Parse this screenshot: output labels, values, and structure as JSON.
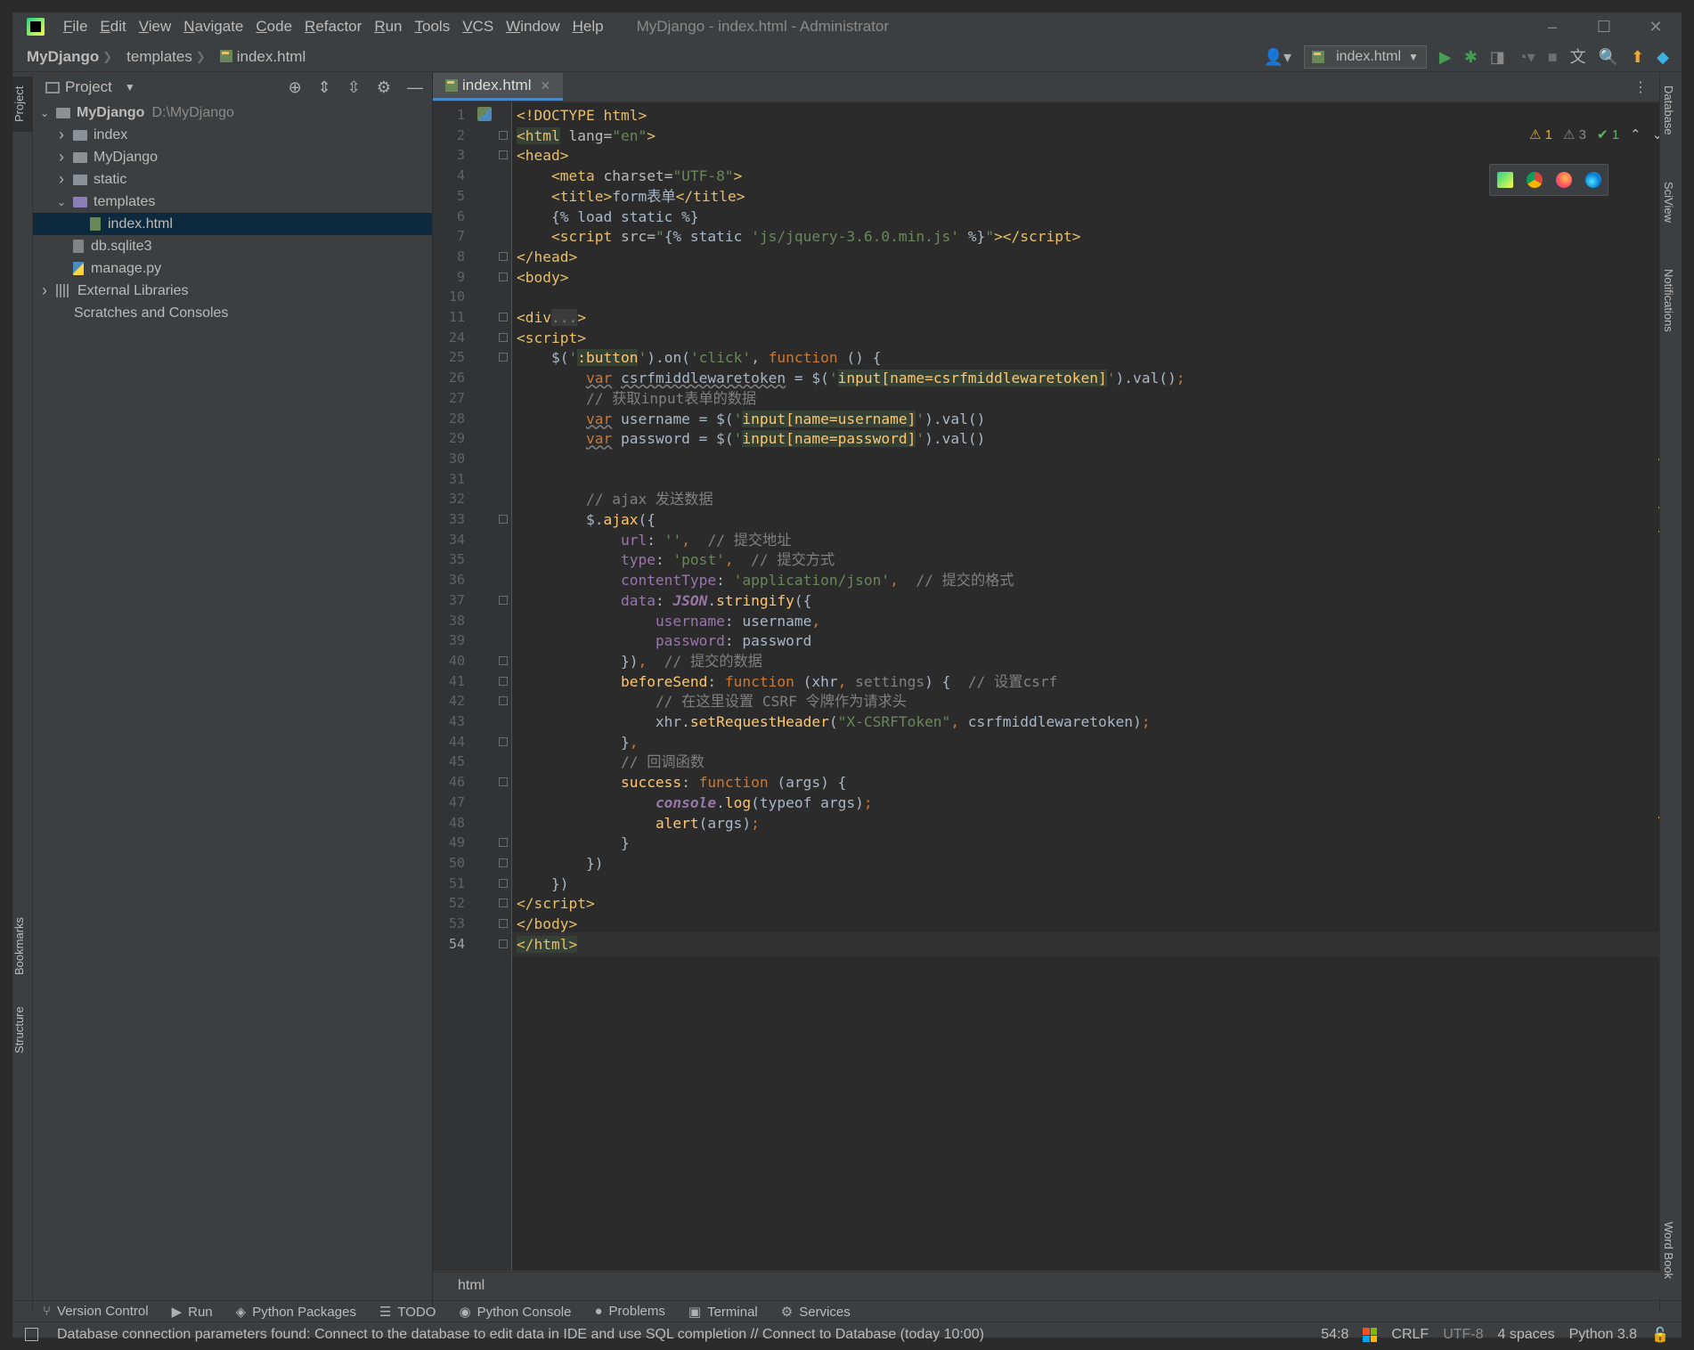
{
  "window": {
    "title": "MyDjango - index.html - Administrator",
    "menu": [
      "File",
      "Edit",
      "View",
      "Navigate",
      "Code",
      "Refactor",
      "Run",
      "Tools",
      "VCS",
      "Window",
      "Help"
    ],
    "controls": [
      "–",
      "☐",
      "✕"
    ]
  },
  "navbar": {
    "crumbs": [
      "MyDjango",
      "templates",
      "index.html"
    ],
    "run_config": "index.html"
  },
  "project_panel": {
    "title": "Project",
    "tree": [
      {
        "label": "MyDjango",
        "detail": "D:\\MyDjango",
        "level": 0,
        "expanded": true,
        "type": "project"
      },
      {
        "label": "index",
        "level": 1,
        "expanded": false,
        "type": "folder"
      },
      {
        "label": "MyDjango",
        "level": 1,
        "expanded": false,
        "type": "folder"
      },
      {
        "label": "static",
        "level": 1,
        "expanded": false,
        "type": "folder"
      },
      {
        "label": "templates",
        "level": 1,
        "expanded": true,
        "type": "template-folder"
      },
      {
        "label": "index.html",
        "level": 2,
        "type": "html",
        "selected": true
      },
      {
        "label": "db.sqlite3",
        "level": 1,
        "type": "db"
      },
      {
        "label": "manage.py",
        "level": 1,
        "type": "py"
      },
      {
        "label": "External Libraries",
        "level": 0,
        "expanded": false,
        "type": "lib"
      },
      {
        "label": "Scratches and Consoles",
        "level": 0,
        "type": "scratch"
      }
    ]
  },
  "left_tabs": {
    "project": "Project",
    "bookmarks": "Bookmarks",
    "structure": "Structure"
  },
  "right_tabs": {
    "database": "Database",
    "sciview": "SciView",
    "notifications": "Notifications",
    "wordbook": "Word Book"
  },
  "editor": {
    "tab": "index.html",
    "current_line": 54,
    "inspections": {
      "warnings_a": "1",
      "warnings_b": "3",
      "ok": "1"
    },
    "lines": [
      {
        "n": 1,
        "html": "<span class='tag'>&lt;!DOCTYPE </span><span class='tag'>html</span><span class='tag'>&gt;</span>"
      },
      {
        "n": 2,
        "html": "<span class='tag hl'>&lt;html</span><span class='attr'> lang=</span><span class='str'>\"en\"</span><span class='tag'>&gt;</span>"
      },
      {
        "n": 3,
        "html": "<span class='tag'>&lt;head&gt;</span>"
      },
      {
        "n": 4,
        "html": "    <span class='tag'>&lt;meta </span><span class='attr'>charset=</span><span class='str'>\"UTF-8\"</span><span class='tag'>&gt;</span>"
      },
      {
        "n": 5,
        "html": "    <span class='tag'>&lt;title&gt;</span>form表单<span class='tag'>&lt;/title&gt;</span>"
      },
      {
        "n": 6,
        "html": "    {% load static %}"
      },
      {
        "n": 7,
        "html": "    <span class='tag'>&lt;script </span><span class='attr'>src=</span><span class='str'>\"</span>{% static <span class='str'>'js/jquery-3.6.0.min.js'</span> %}<span class='str'>\"</span><span class='tag'>&gt;&lt;/script&gt;</span>"
      },
      {
        "n": 8,
        "html": "<span class='tag'>&lt;/head&gt;</span>"
      },
      {
        "n": 9,
        "html": "<span class='tag'>&lt;body&gt;</span>"
      },
      {
        "n": 10,
        "html": ""
      },
      {
        "n": 11,
        "html": "<span class='tag'>&lt;div</span><span class='cmt' style='background:#3b3b3b'>...</span><span class='tag'>&gt;</span>"
      },
      {
        "n": 24,
        "html": "<span class='tag'>&lt;script&gt;</span>"
      },
      {
        "n": 25,
        "html": "    $(<span class='str'>'</span><span class='fn hl'>:button</span><span class='str'>'</span>).on(<span class='str'>'click'</span>, <span class='kw'>function</span> () {"
      },
      {
        "n": 26,
        "html": "        <span class='kw u'>var</span> <span class='u'>csrfmiddlewaretoken</span> = $(<span class='str'>'</span><span class='fn hl'>input[name=csrfmiddlewaretoken]</span><span class='str'>'</span>).val()<span class='kw'>;</span>"
      },
      {
        "n": 27,
        "html": "        <span class='cmt'>// 获取input表单的数据</span>"
      },
      {
        "n": 28,
        "html": "        <span class='kw u'>var</span> username = $(<span class='str'>'</span><span class='fn hl'>input[name=username]</span><span class='str'>'</span>).val()"
      },
      {
        "n": 29,
        "html": "        <span class='kw u'>var</span> password = $(<span class='str'>'</span><span class='fn hl'>input[name=password]</span><span class='str'>'</span>).val()"
      },
      {
        "n": 30,
        "html": ""
      },
      {
        "n": 31,
        "html": ""
      },
      {
        "n": 32,
        "html": "        <span class='cmt'>// ajax 发送数据</span>"
      },
      {
        "n": 33,
        "html": "        $.<span class='fn'>ajax</span>({"
      },
      {
        "n": 34,
        "html": "            <span class='prop'>url</span>: <span class='str'>''</span><span class='kw'>,</span>  <span class='cmt'>// 提交地址</span>"
      },
      {
        "n": 35,
        "html": "            <span class='prop'>type</span>: <span class='str'>'post'</span><span class='kw'>,</span>  <span class='cmt'>// 提交方式</span>"
      },
      {
        "n": 36,
        "html": "            <span class='prop'>contentType</span>: <span class='str'>'application/json'</span><span class='kw'>,</span>  <span class='cmt'>// 提交的格式</span>"
      },
      {
        "n": 37,
        "html": "            <span class='prop'>data</span>: <span class='ital'>JSON</span>.<span class='fn'>stringify</span>({"
      },
      {
        "n": 38,
        "html": "                <span class='prop'>username</span>: username<span class='kw'>,</span>"
      },
      {
        "n": 39,
        "html": "                <span class='prop'>password</span>: password"
      },
      {
        "n": 40,
        "html": "            })<span class='kw'>,</span>  <span class='cmt'>// 提交的数据</span>"
      },
      {
        "n": 41,
        "html": "            <span class='fn'>beforeSend</span>: <span class='kw'>function</span> (xhr<span class='kw'>,</span> <span class='cmt' style='color:#808080'>settings</span>) {  <span class='cmt'>// 设置csrf</span>"
      },
      {
        "n": 42,
        "html": "                <span class='cmt'>// 在这里设置 CSRF 令牌作为请求头</span>"
      },
      {
        "n": 43,
        "html": "                xhr.<span class='fn'>setRequestHeader</span>(<span class='str'>\"X-CSRFToken\"</span><span class='kw'>,</span> csrfmiddlewaretoken)<span class='kw'>;</span>"
      },
      {
        "n": 44,
        "html": "            }<span class='kw'>,</span>"
      },
      {
        "n": 45,
        "html": "            <span class='cmt'>// 回调函数</span>"
      },
      {
        "n": 46,
        "html": "            <span class='fn'>success</span>: <span class='kw'>function</span> (args) {"
      },
      {
        "n": 47,
        "html": "                <span class='ital'>console</span>.<span class='fn'>log</span>(typeof args)<span class='kw'>;</span>"
      },
      {
        "n": 48,
        "html": "                <span class='fn'>alert</span>(args)<span class='kw'>;</span>"
      },
      {
        "n": 49,
        "html": "            }"
      },
      {
        "n": 50,
        "html": "        })"
      },
      {
        "n": 51,
        "html": "    })"
      },
      {
        "n": 52,
        "html": "<span class='tag'>&lt;/script&gt;</span>"
      },
      {
        "n": 53,
        "html": "<span class='tag'>&lt;/body&gt;</span>"
      },
      {
        "n": 54,
        "html": "<span class='tag hl'>&lt;/html&gt;</span>"
      }
    ],
    "breadcrumb": "html"
  },
  "bottom_tools": [
    "Version Control",
    "Run",
    "Python Packages",
    "TODO",
    "Python Console",
    "Problems",
    "Terminal",
    "Services"
  ],
  "status": {
    "message": "Database connection parameters found: Connect to the database to edit data in IDE and use SQL completion // Connect to Database (today 10:00)",
    "position": "54:8",
    "line_sep": "CRLF",
    "encoding": "UTF-8",
    "indent": "4 spaces",
    "interpreter": "Python 3.8"
  }
}
